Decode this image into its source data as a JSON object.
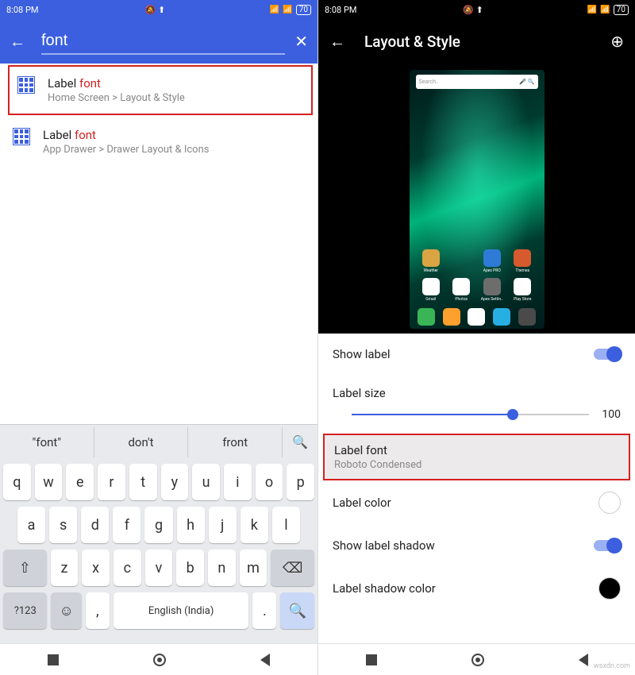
{
  "statusbar": {
    "time": "8:08 PM",
    "battery": "70"
  },
  "left": {
    "search_value": "font",
    "results": [
      {
        "pre": "Label ",
        "match": "font",
        "path": "Home Screen > Layout & Style"
      },
      {
        "pre": "Label ",
        "match": "font",
        "path": "App Drawer > Drawer Layout & Icons"
      }
    ],
    "suggestions": [
      "\"font\"",
      "don't",
      "front"
    ],
    "keyboard": {
      "row1": [
        "q",
        "w",
        "e",
        "r",
        "t",
        "y",
        "u",
        "i",
        "o",
        "p"
      ],
      "row2": [
        "a",
        "s",
        "d",
        "f",
        "g",
        "h",
        "j",
        "k",
        "l"
      ],
      "row3_shift": "⇧",
      "row3": [
        "z",
        "x",
        "c",
        "v",
        "b",
        "n",
        "m"
      ],
      "row3_bksp": "⌫",
      "sym": "?123",
      "emoji": "☺",
      "comma": ",",
      "space": "English (India)",
      "period": ".",
      "enter": "🔍"
    }
  },
  "right": {
    "title": "Layout & Style",
    "preview": {
      "search_placeholder": "Search..",
      "apps_row1": [
        {
          "label": "Weather",
          "color": "#d9a441"
        },
        {
          "label": "",
          "color": "transparent"
        },
        {
          "label": "Apex PRO",
          "color": "#2d7bd6"
        },
        {
          "label": "Themes",
          "color": "#d65a2d"
        }
      ],
      "apps_row2": [
        {
          "label": "Gmail",
          "color": "#ffffff"
        },
        {
          "label": "Photos",
          "color": "#ffffff"
        },
        {
          "label": "Apex Settin..",
          "color": "#6d6d6d"
        },
        {
          "label": "Play Store",
          "color": "#ffffff"
        }
      ],
      "dock": [
        "#39b556",
        "#ff9f2e",
        "#ffffff",
        "#27aee3",
        "#4a4a4a"
      ]
    },
    "settings": {
      "show_label": "Show label",
      "label_size": "Label size",
      "label_size_value": "100",
      "label_font": "Label font",
      "label_font_value": "Roboto Condensed",
      "label_color": "Label color",
      "label_color_value": "#ffffff",
      "show_shadow": "Show label shadow",
      "shadow_color": "Label shadow color",
      "shadow_color_value": "#000000"
    }
  },
  "watermark": "wsxdn.com"
}
